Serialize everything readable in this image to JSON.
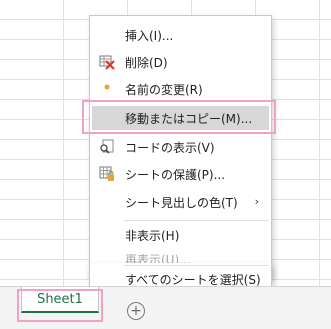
{
  "context_menu": {
    "items": [
      {
        "label": "挿入(I)...",
        "icon": ""
      },
      {
        "label": "削除(D)",
        "icon": "delete-sheet-icon"
      },
      {
        "label": "名前の変更(R)",
        "icon": "rename-dot-icon"
      },
      {
        "label": "移動またはコピー(M)...",
        "icon": ""
      },
      {
        "label": "コードの表示(V)",
        "icon": "view-code-icon"
      },
      {
        "label": "シートの保護(P)...",
        "icon": "protect-sheet-icon"
      },
      {
        "label": "シート見出しの色(T)",
        "icon": "",
        "submenu_arrow": "›"
      },
      {
        "label": "非表示(H)",
        "icon": ""
      },
      {
        "label": "再表示(U)...",
        "icon": "",
        "disabled": true
      },
      {
        "label": "すべてのシートを選択(S)",
        "icon": ""
      }
    ]
  },
  "sheet_tabs": {
    "tabs": [
      "Sheet1"
    ],
    "add_sheet_glyph": "+"
  },
  "colors": {
    "accent_green": "#217346",
    "highlight_pink": "#f0a3c8"
  }
}
